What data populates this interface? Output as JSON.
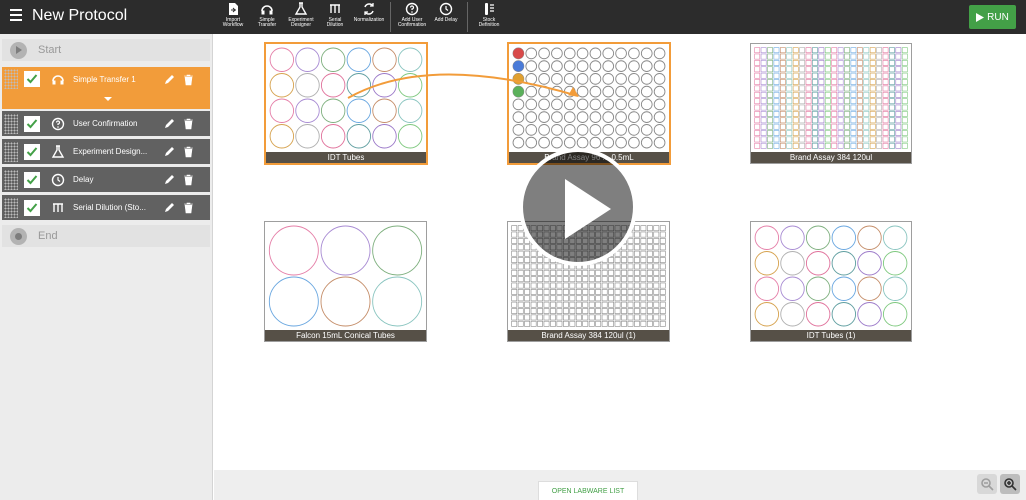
{
  "header": {
    "title": "New Protocol",
    "run_label": "RUN",
    "tools": [
      {
        "label": "Import\nWorkflow",
        "icon": "import-icon"
      },
      {
        "label": "Simple\nTransfer",
        "icon": "headphones-icon"
      },
      {
        "label": "Experiment\nDesigner",
        "icon": "flask-icon"
      },
      {
        "label": "Serial\nDilution",
        "icon": "dilution-icon"
      },
      {
        "label": "Normalization",
        "icon": "normalization-icon"
      },
      {
        "label": "Add User\nConfirmation",
        "icon": "question-icon"
      },
      {
        "label": "Add Delay",
        "icon": "clock-icon"
      },
      {
        "label": "Stock\nDefinition",
        "icon": "stock-icon"
      }
    ]
  },
  "sidebar": {
    "start_label": "Start",
    "end_label": "End",
    "steps": [
      {
        "label": "Simple Transfer 1",
        "icon": "headphones-icon",
        "active": true
      },
      {
        "label": "User Confirmation",
        "icon": "question-icon",
        "active": false
      },
      {
        "label": "Experiment Design...",
        "icon": "flask-icon",
        "active": false
      },
      {
        "label": "Delay",
        "icon": "clock-icon",
        "active": false
      },
      {
        "label": "Serial Dilution (Sto...",
        "icon": "dilution-icon",
        "active": false
      }
    ]
  },
  "plates": [
    {
      "name": "IDT Tubes",
      "rows": 4,
      "cols": 6,
      "shape": "circle",
      "selected": true
    },
    {
      "name": "Brand Assay 96 ... 0.5mL",
      "rows": 8,
      "cols": 12,
      "shape": "circle",
      "selected": true
    },
    {
      "name": "Brand Assay 384 120ul",
      "rows": 16,
      "cols": 24,
      "shape": "square",
      "selected": false
    },
    {
      "name": "Falcon 15mL Conical Tubes",
      "rows": 2,
      "cols": 3,
      "shape": "circle",
      "selected": false
    },
    {
      "name": "Brand Assay 384 120ul (1)",
      "rows": 16,
      "cols": 24,
      "shape": "square",
      "selected": false
    },
    {
      "name": "IDT Tubes (1)",
      "rows": 4,
      "cols": 6,
      "shape": "circle",
      "selected": false
    }
  ],
  "footer": {
    "open_labware_label": "OPEN LABWARE LIST"
  },
  "colors": {
    "accent": "#f29c3a",
    "run": "#43a047",
    "topbar": "#2c2c2c",
    "step_bg": "#616161"
  }
}
